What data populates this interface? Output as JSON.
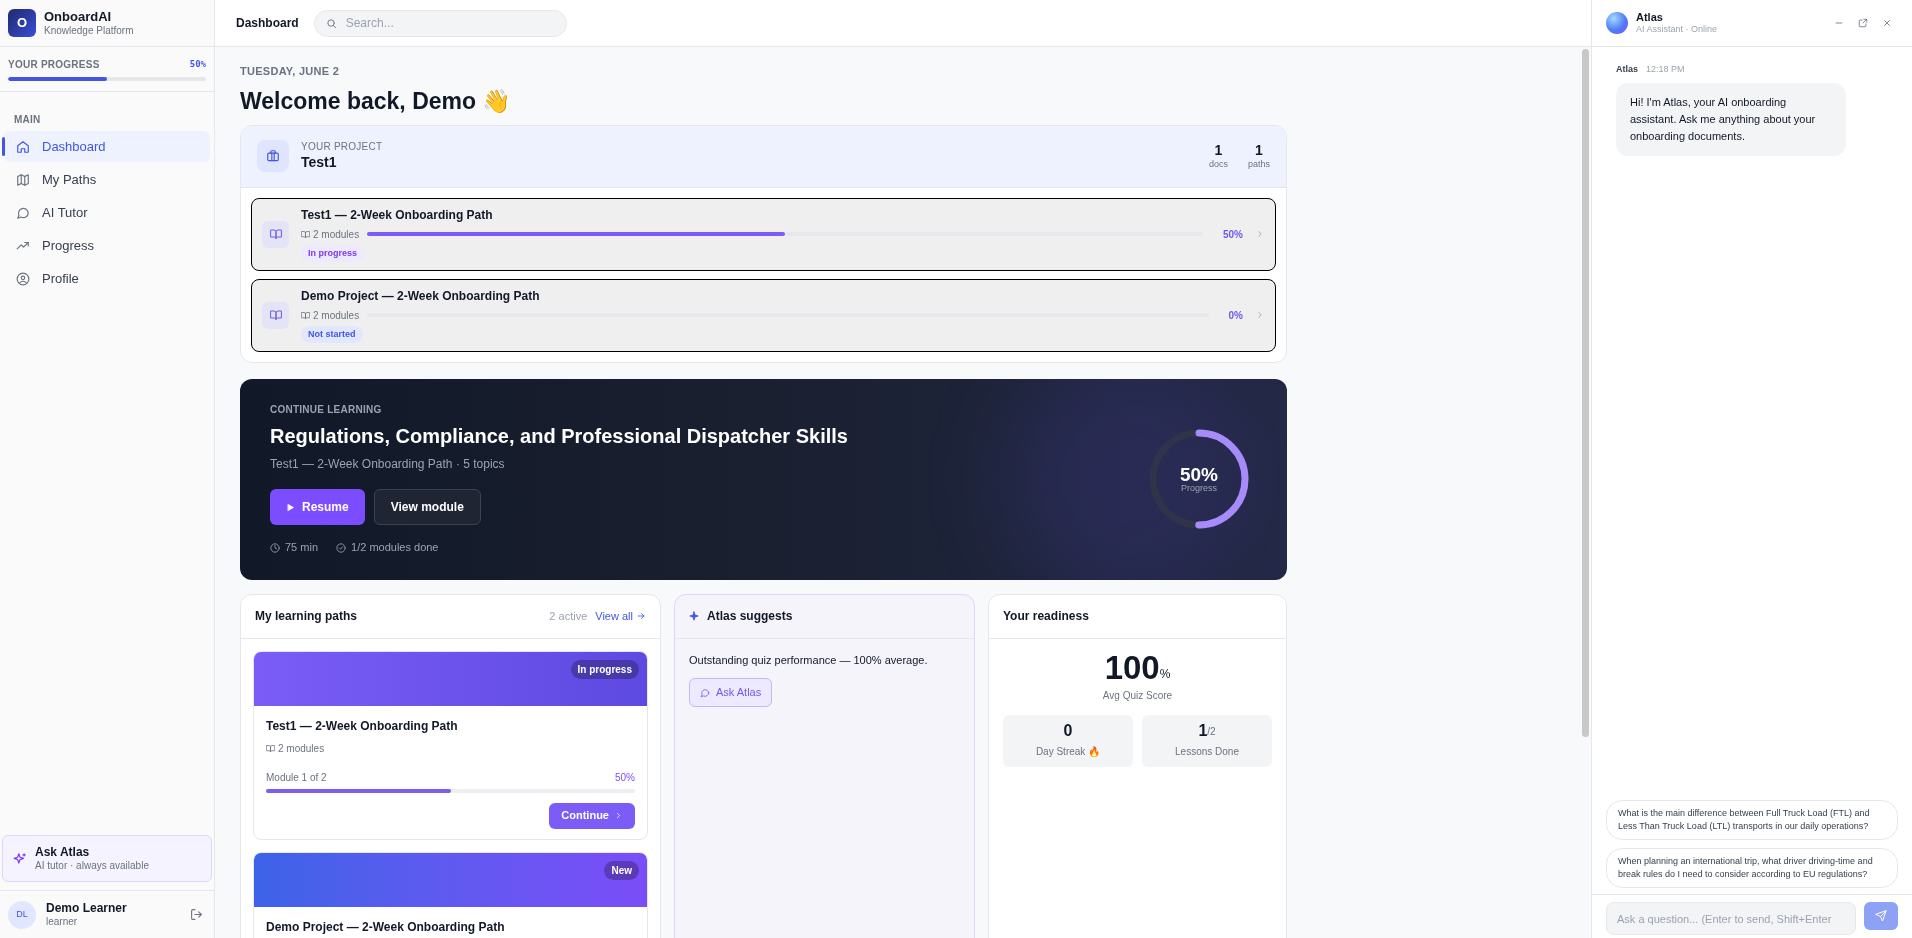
{
  "brand": {
    "logo_letter": "O",
    "name": "OnboardAI",
    "tagline": "Knowledge Platform"
  },
  "progress": {
    "label": "YOUR PROGRESS",
    "reading": "50%",
    "level": 0.5
  },
  "nav": {
    "section": "MAIN",
    "items": [
      {
        "label": "Dashboard",
        "selected": true
      },
      {
        "label": "My Paths",
        "selected": false
      },
      {
        "label": "AI Tutor",
        "selected": false
      },
      {
        "label": "Progress",
        "selected": false
      },
      {
        "label": "Profile",
        "selected": false
      }
    ]
  },
  "ask_atlas": {
    "title": "Ask Atlas",
    "subtitle": "AI tutor · always available"
  },
  "user": {
    "initials": "DL",
    "name": "Demo Learner",
    "role": "learner"
  },
  "topbar": {
    "title": "Dashboard",
    "search": {
      "placeholder": "Search..."
    }
  },
  "date": "TUESDAY, JUNE 2",
  "greeting": "Welcome back, Demo 👋",
  "project": {
    "label": "YOUR PROJECT",
    "name": "Test1",
    "stats": [
      {
        "value": "1",
        "label": "docs"
      },
      {
        "value": "1",
        "label": "paths"
      }
    ],
    "paths": [
      {
        "title": "Test1 — 2-Week Onboarding Path",
        "modules": "2 modules",
        "status": "In progress",
        "kind": "in_progress",
        "level": 0.5,
        "reading": "50%"
      },
      {
        "title": "Demo Project — 2-Week Onboarding Path",
        "modules": "2 modules",
        "status": "Not started",
        "kind": "not_started",
        "level": 0,
        "reading": "0%"
      }
    ]
  },
  "continue": {
    "eyebrow": "CONTINUE LEARNING",
    "title": "Regulations, Compliance, and Professional Dispatcher Skills",
    "subtitle": "Test1 — 2-Week Onboarding Path · 5 topics",
    "buttons": [
      {
        "label": "Resume",
        "kind": "primary"
      },
      {
        "label": "View module",
        "kind": "secondary"
      }
    ],
    "meta": [
      "75 min",
      "1/2 modules done"
    ],
    "ring": {
      "reading": "50%",
      "label": "Progress",
      "level": 0.5
    }
  },
  "learning_paths": {
    "title": "My learning paths",
    "count": "2 active",
    "link": "View all",
    "cards": [
      {
        "badge": "In progress",
        "kind": "in_progress",
        "title": "Test1 — 2-Week Onboarding Path",
        "modules": "2 modules",
        "progress_label": "Module 1 of 2",
        "reading": "50%",
        "level": 0.5,
        "button": "Continue"
      },
      {
        "badge": "New",
        "kind": "new",
        "title": "Demo Project — 2-Week Onboarding Path"
      }
    ]
  },
  "suggests": {
    "title": "Atlas suggests",
    "text": "Outstanding quiz performance — 100% average.",
    "button": "Ask Atlas"
  },
  "readiness": {
    "title": "Your readiness",
    "score": "100",
    "score_unit": "%",
    "score_label": "Avg Quiz Score",
    "stats": [
      {
        "value": "0",
        "label": "Day Streak 🔥"
      },
      {
        "value": "1",
        "suffix": "/2",
        "label": "Lessons Done"
      }
    ]
  },
  "chat": {
    "name": "Atlas",
    "status": "AI Assistant · Online",
    "messages": [
      {
        "sender": "Atlas",
        "time": "12:18 PM",
        "text": "Hi! I'm Atlas, your AI onboarding assistant. Ask me anything about your onboarding documents."
      }
    ],
    "suggestions": [
      "What is the main difference between Full Truck Load (FTL) and Less Than Truck Load (LTL) transports in our daily operations?",
      "When planning an international trip, what driver driving-time and break rules do I need to consider according to EU regulations?"
    ],
    "input": {
      "placeholder": "Ask a question... (Enter to send, Shift+Enter"
    }
  }
}
